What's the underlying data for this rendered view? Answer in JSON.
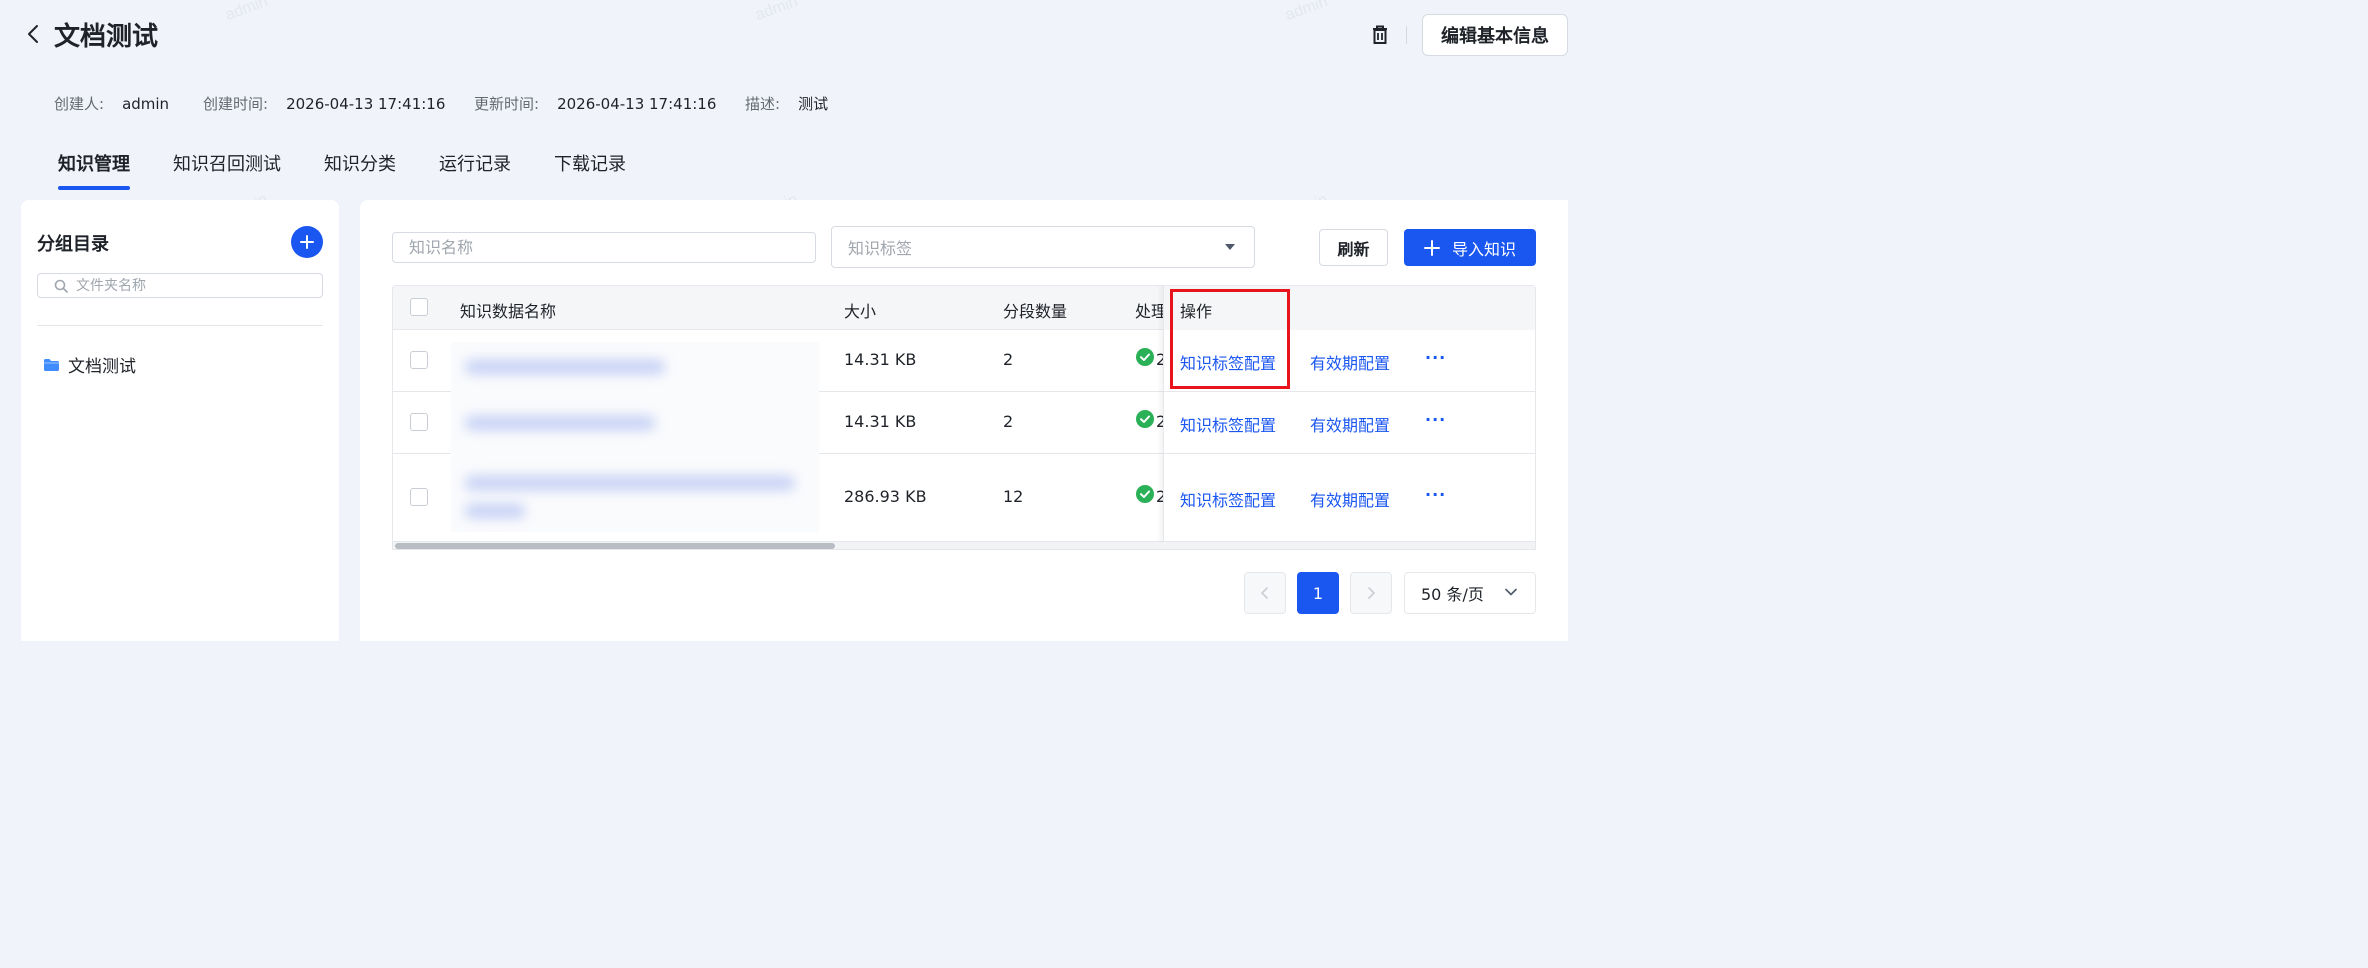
{
  "header": {
    "title": "文档测试",
    "edit_button": "编辑基本信息"
  },
  "meta": {
    "creator_label": "创建人:",
    "creator": "admin",
    "created_label": "创建时间:",
    "created": "2026-04-13 17:41:16",
    "updated_label": "更新时间:",
    "updated": "2026-04-13 17:41:16",
    "desc_label": "描述:",
    "desc": "测试"
  },
  "tabs": [
    {
      "label": "知识管理",
      "active": true
    },
    {
      "label": "知识召回测试",
      "active": false
    },
    {
      "label": "知识分类",
      "active": false
    },
    {
      "label": "运行记录",
      "active": false
    },
    {
      "label": "下载记录",
      "active": false
    }
  ],
  "sidebar": {
    "title": "分组目录",
    "search_placeholder": "文件夹名称",
    "folders": [
      {
        "label": "文档测试"
      }
    ]
  },
  "toolbar": {
    "name_placeholder": "知识名称",
    "tag_placeholder": "知识标签",
    "refresh": "刷新",
    "import": "导入知识"
  },
  "table": {
    "columns": {
      "name": "知识数据名称",
      "size": "大小",
      "segments": "分段数量",
      "status": "处理",
      "ops": "操作"
    },
    "rows": [
      {
        "size": "14.31 KB",
        "segments": "2",
        "status_fragment": "2",
        "op_tag": "知识标签配置",
        "op_expiry": "有效期配置",
        "op_more": "···"
      },
      {
        "size": "14.31 KB",
        "segments": "2",
        "status_fragment": "2",
        "op_tag": "知识标签配置",
        "op_expiry": "有效期配置",
        "op_more": "···"
      },
      {
        "size": "286.93 KB",
        "segments": "12",
        "status_fragment": "2",
        "op_tag": "知识标签配置",
        "op_expiry": "有效期配置",
        "op_more": "···"
      }
    ]
  },
  "pagination": {
    "current": "1",
    "page_size": "50 条/页"
  },
  "watermark": "admin",
  "colors": {
    "accent": "#1a56f0",
    "success": "#2ab056",
    "highlight": "#e8141c"
  }
}
